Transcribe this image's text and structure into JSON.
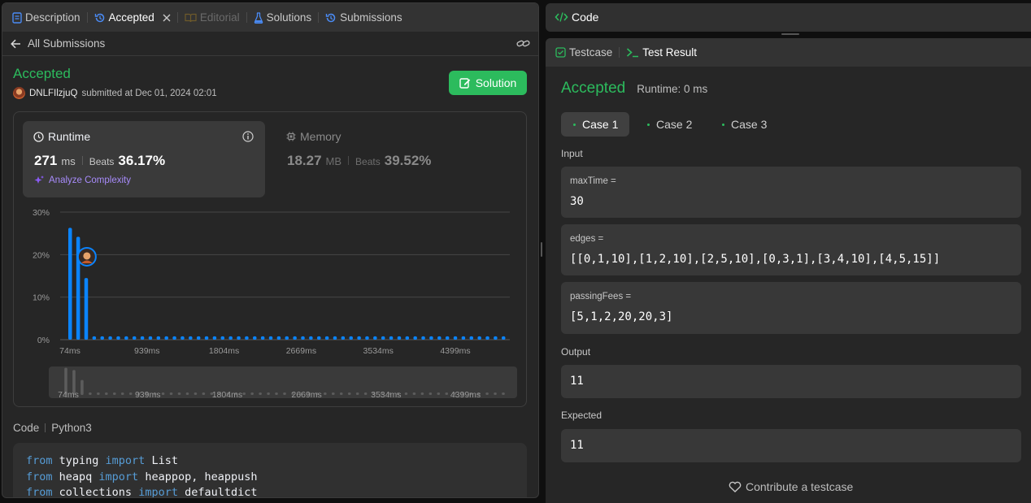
{
  "left_tabs": {
    "description": "Description",
    "accepted": "Accepted",
    "editorial": "Editorial",
    "solutions": "Solutions",
    "submissions": "Submissions"
  },
  "subbar": {
    "back_label": "All Submissions"
  },
  "submission": {
    "status": "Accepted",
    "username": "DNLFIlzjuQ",
    "submitted_text": "submitted at Dec 01, 2024 02:01",
    "solution_button": "Solution"
  },
  "runtime": {
    "title": "Runtime",
    "value": "271",
    "unit": "ms",
    "beats_label": "Beats",
    "beats_value": "36.17%",
    "analyze_label": "Analyze Complexity"
  },
  "memory": {
    "title": "Memory",
    "value": "18.27",
    "unit": "MB",
    "beats_label": "Beats",
    "beats_value": "39.52%"
  },
  "chart_data": {
    "type": "bar",
    "y_ticks": [
      "30%",
      "20%",
      "10%",
      "0%"
    ],
    "ylim": [
      0,
      30
    ],
    "x_ticks": [
      "74ms",
      "939ms",
      "1804ms",
      "2669ms",
      "3534ms",
      "4399ms"
    ],
    "values": [
      26.3,
      24.2,
      14.5,
      0.8,
      0.8,
      0.8,
      0.8,
      0.8,
      0.8,
      0.8,
      0.8,
      0.8,
      0.8,
      0.8,
      0.8,
      0.8,
      0.8,
      0.8,
      0.8,
      0.8,
      0.8,
      0.8,
      0.8,
      0.8,
      0.8,
      0.8,
      0.8,
      0.8,
      0.8,
      0.8,
      0.8,
      0.8,
      0.8,
      0.8,
      0.8,
      0.8,
      0.8,
      0.8,
      0.8,
      0.8,
      0.8,
      0.8,
      0.8,
      0.8,
      0.8,
      0.8,
      0.8,
      0.8,
      0.8,
      0.8,
      0.8,
      0.8,
      0.8,
      0.8,
      0.8
    ],
    "user_bar_index": 1,
    "user_value": 19.5,
    "bar_color": "#0a84ff",
    "grid": true
  },
  "code_section": {
    "label": "Code",
    "language": "Python3",
    "lines": [
      [
        {
          "t": "from",
          "k": true
        },
        {
          "t": " typing ",
          "k": false
        },
        {
          "t": "import",
          "k": true
        },
        {
          "t": " List",
          "k": false
        }
      ],
      [
        {
          "t": "from",
          "k": true
        },
        {
          "t": " heapq ",
          "k": false
        },
        {
          "t": "import",
          "k": true
        },
        {
          "t": " heappop, heappush",
          "k": false
        }
      ],
      [
        {
          "t": "from",
          "k": true
        },
        {
          "t": " collections ",
          "k": false
        },
        {
          "t": "import",
          "k": true
        },
        {
          "t": " defaultdict",
          "k": false
        }
      ]
    ]
  },
  "code_pane": {
    "title": "Code"
  },
  "result_tabs": {
    "testcase": "Testcase",
    "test_result": "Test Result"
  },
  "result": {
    "status": "Accepted",
    "runtime_text": "Runtime: 0 ms",
    "cases": [
      "Case 1",
      "Case 2",
      "Case 3"
    ],
    "input_label": "Input",
    "inputs": [
      {
        "name": "maxTime =",
        "value": "30"
      },
      {
        "name": "edges =",
        "value": "[[0,1,10],[1,2,10],[2,5,10],[0,3,1],[3,4,10],[4,5,15]]"
      },
      {
        "name": "passingFees =",
        "value": "[5,1,2,20,20,3]"
      }
    ],
    "output_label": "Output",
    "output_value": "11",
    "expected_label": "Expected",
    "expected_value": "11",
    "contribute_label": "Contribute a testcase"
  },
  "colors": {
    "accent_green": "#2cbb5d",
    "bar_blue": "#0a84ff",
    "purple": "#a78bfa"
  }
}
